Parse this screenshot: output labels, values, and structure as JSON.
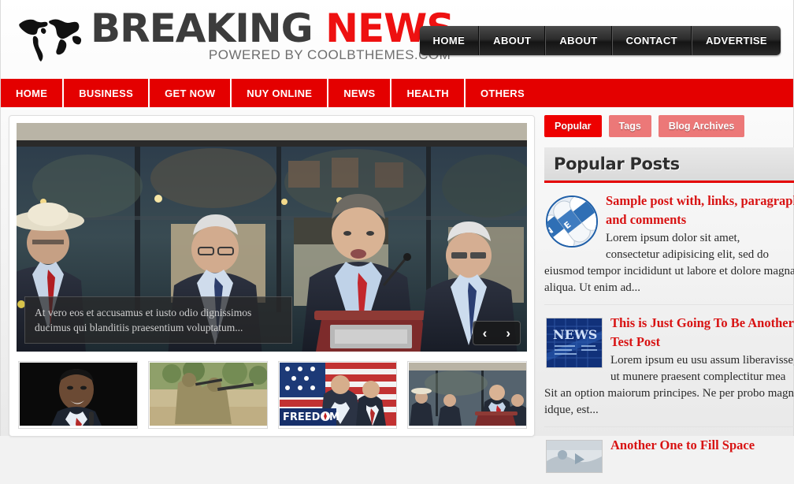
{
  "site": {
    "logo_primary": "BREAKING",
    "logo_accent": "NEWS",
    "tagline": "POWERED BY COOLBTHEMES.COM",
    "accent_color": "#e40000",
    "logo_gray": "#3c3c3c"
  },
  "top_nav": {
    "items": [
      {
        "label": "HOME"
      },
      {
        "label": "ABOUT"
      },
      {
        "label": "ABOUT"
      },
      {
        "label": "CONTACT"
      },
      {
        "label": "ADVERTISE"
      }
    ]
  },
  "main_menu": {
    "items": [
      {
        "label": "HOME"
      },
      {
        "label": "BUSINESS"
      },
      {
        "label": "GET NOW"
      },
      {
        "label": "NUY ONLINE"
      },
      {
        "label": "NEWS"
      },
      {
        "label": "HEALTH"
      },
      {
        "label": "OTHERS"
      }
    ]
  },
  "slider": {
    "caption": "At vero eos et accusamus et iusto odio dignissimos ducimus qui blanditiis praesentium voluptatum...",
    "prev_icon": "‹",
    "next_icon": "›",
    "hero_alt": "press-conference-podium"
  },
  "thumbnails": [
    {
      "name": "portrait-speaker-thumbnail"
    },
    {
      "name": "soldiers-desert-thumbnail"
    },
    {
      "name": "freedom-rally-thumbnail"
    },
    {
      "name": "press-conference-thumbnail"
    }
  ],
  "sidebar": {
    "tabs": [
      {
        "label": "Popular",
        "active": true
      },
      {
        "label": "Tags",
        "active": false
      },
      {
        "label": "Blog Archives",
        "active": false
      }
    ],
    "widget_title": "Popular Posts",
    "posts": [
      {
        "title_line1": "Sample post with, links, paragraph",
        "title_line2": "and comments",
        "body_line1": "Lorem ipsum dolor sit amet,",
        "body_line2": "consectetur adipisicing elit, sed do",
        "body_line3": "eiusmod tempor incididunt ut labore et dolore magna",
        "body_line4": "aliqua. Ut enim ad...",
        "thumb": "newspaper-rolls-circle"
      },
      {
        "title_line1": "This is Just Going To Be Another",
        "title_line2": "Test Post",
        "body_line1": "Lorem ipsum eu usu assum liberavisse,",
        "body_line2": "ut munere praesent complectitur mea",
        "body_line3": "Sit an option maiorum principes. Ne per probo magna",
        "body_line4": "idque, est...",
        "thumb": "news-banner-square"
      },
      {
        "title_line1": "Another One to Fill Space",
        "title_line2": "",
        "body_line1": "",
        "body_line2": "",
        "body_line3": "",
        "body_line4": "",
        "thumb": "light-photo-square"
      }
    ]
  }
}
